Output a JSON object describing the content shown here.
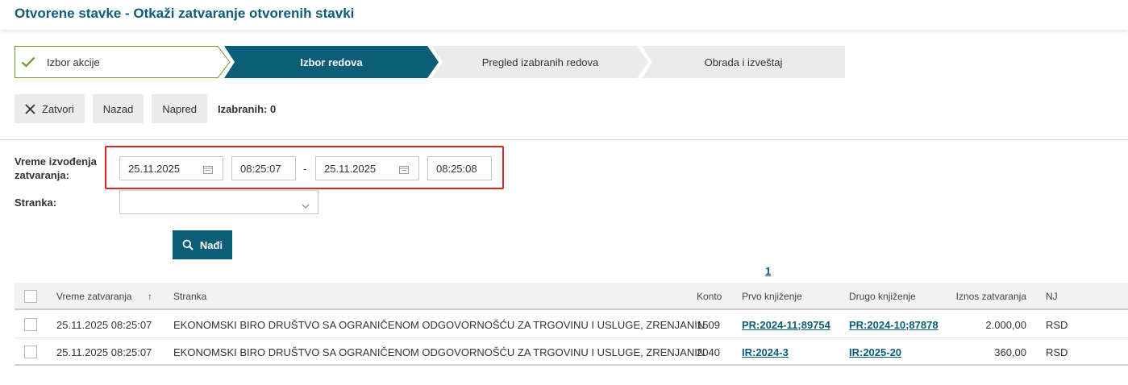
{
  "page": {
    "title": "Otvorene stavke - Otkaži zatvaranje otvorenih stavki"
  },
  "wizard": {
    "steps": [
      {
        "label": "Izbor akcije",
        "state": "done"
      },
      {
        "label": "Izbor redova",
        "state": "active"
      },
      {
        "label": "Pregled izabranih redova",
        "state": "pending"
      },
      {
        "label": "Obrada i izveštaj",
        "state": "pending"
      }
    ]
  },
  "toolbar": {
    "close_label": "Zatvori",
    "back_label": "Nazad",
    "next_label": "Napred",
    "selected_text": "Izabranih: 0"
  },
  "filters": {
    "time_label": "Vreme izvođenja zatvaranja:",
    "date_from": "25.11.2025",
    "time_from": "08:25:07",
    "separator": "-",
    "date_to": "25.11.2025",
    "time_to": "08:25:08",
    "partner_label": "Stranka:",
    "partner_value": "",
    "find_label": "Nađi"
  },
  "pagination": {
    "current": "1"
  },
  "table": {
    "columns": [
      "Vreme zatvaranja",
      "Stranka",
      "Konto",
      "Prvo knjiženje",
      "Drugo knjiženje",
      "Iznos zatvaranja",
      "NJ"
    ],
    "sort_indicator": "↑",
    "rows": [
      {
        "vreme": "25.11.2025 08:25:07",
        "stranka": "EKONOMSKI BIRO DRUŠTVO SA OGRANIČENOM ODGOVORNOŠĆU ZA TRGOVINU I USLUGE, ZRENJANIN",
        "konto": "1509",
        "prvo": "PR:2024-11;89754",
        "drugo": "PR:2024-10;87878",
        "iznos": "2.000,00",
        "nj": "RSD"
      },
      {
        "vreme": "25.11.2025 08:25:07",
        "stranka": "EKONOMSKI BIRO DRUŠTVO SA OGRANIČENOM ODGOVORNOŠĆU ZA TRGOVINU I USLUGE, ZRENJANIN",
        "konto": "2040",
        "prvo": "IR:2024-3",
        "drugo": "IR:2025-20",
        "iznos": "360,00",
        "nj": "RSD"
      }
    ]
  },
  "colors": {
    "primary": "#0b5d78",
    "step_inactive": "#ebebeb",
    "highlight": "#d9262c",
    "check": "#6a9a2a"
  }
}
